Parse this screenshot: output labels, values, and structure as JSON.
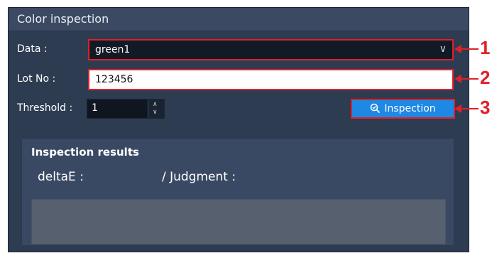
{
  "panel": {
    "title": "Color inspection"
  },
  "form": {
    "data_label": "Data :",
    "data_value": "green1",
    "lot_label": "Lot No :",
    "lot_value": "123456",
    "threshold_label": "Threshold :",
    "threshold_value": "1",
    "inspection_button": "Inspection"
  },
  "results": {
    "heading": "Inspection results",
    "deltaE_label": "deltaE :",
    "judgment_label": "/ Judgment :"
  },
  "callouts": [
    "1",
    "2",
    "3"
  ],
  "colors": {
    "panel_bg": "#2e3c52",
    "accent_blue": "#1e88e5",
    "callout_red": "#e0202a"
  }
}
